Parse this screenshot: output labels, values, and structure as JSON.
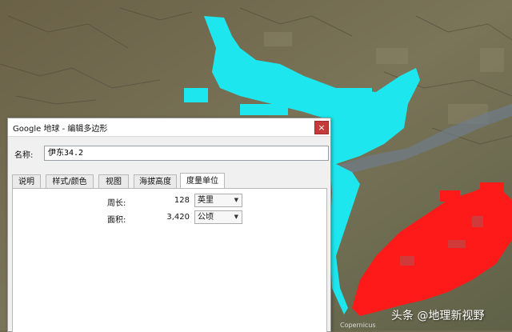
{
  "dialog": {
    "title": "Google 地球 - 编辑多边形",
    "close_label": "×",
    "name_label": "名称:",
    "name_value": "伊东34.2"
  },
  "tabs": [
    {
      "label": "说明",
      "active": false
    },
    {
      "label": "样式/颜色",
      "active": false
    },
    {
      "label": "视图",
      "active": false
    },
    {
      "label": "海拔高度",
      "active": false
    },
    {
      "label": "度量单位",
      "active": true
    }
  ],
  "measurements": {
    "perimeter_label": "周长:",
    "perimeter_value": "128",
    "perimeter_unit": "英里",
    "area_label": "面积:",
    "area_value": "3,420",
    "area_unit": "公顷"
  },
  "map": {
    "watermark": "头条 @地理新视野",
    "credit": "Copernicus",
    "cyan_color": "#1ee6ee",
    "red_color": "#ff1a1a"
  }
}
